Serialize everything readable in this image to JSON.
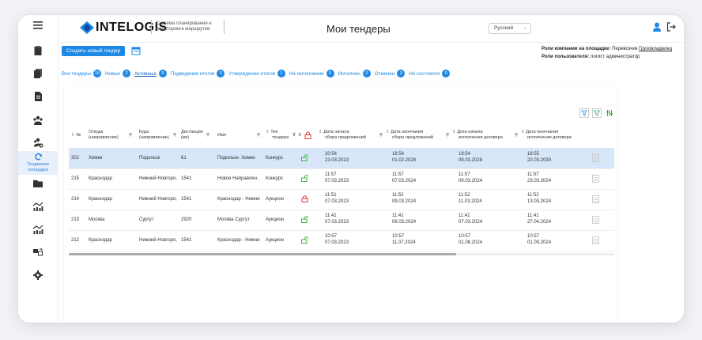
{
  "header": {
    "logo_text": "INTELOGIS",
    "logo_subtitle_line1": "Система планирования и",
    "logo_subtitle_line2": "мониторинга маршрутов",
    "page_title": "Мои тендеры",
    "language": "Русский"
  },
  "sidebar": {
    "active_label_line1": "Тендерная",
    "active_label_line2": "площадка"
  },
  "toolbar": {
    "create_label": "Создать новый тендер"
  },
  "roles": {
    "company_label": "Роли компании на площадке:",
    "company_value": "Перевозчик",
    "company_link": "Грузовладелец",
    "user_label": "Роли пользователя:",
    "user_value": "логист администратор"
  },
  "filters": [
    {
      "label": "Все тендеры",
      "count": "15"
    },
    {
      "label": "Новые",
      "count": "2"
    },
    {
      "label": "Активные",
      "count": "5"
    },
    {
      "label": "Подведение итогов",
      "count": "0"
    },
    {
      "label": "Утверждение итогов",
      "count": "1"
    },
    {
      "label": "На исполнении",
      "count": "0"
    },
    {
      "label": "Исполнен",
      "count": "3"
    },
    {
      "label": "Отменен",
      "count": "3"
    },
    {
      "label": "Не состоялся",
      "count": "0"
    }
  ],
  "table": {
    "headers": {
      "num": "№",
      "from_1": "Откуда",
      "from_2": "(направление)",
      "to_1": "Куда",
      "to_2": "(направление)",
      "dist_1": "Дистанция",
      "dist_2": "(км)",
      "name": "Имя",
      "type_1": "Тип",
      "type_2": "тендера",
      "ofs_1": "Дата начала",
      "ofs_2": "сбора предложений",
      "ofe_1": "Дата окончания",
      "ofe_2": "сбора предложений",
      "cs_1": "Дата начала",
      "cs_2": "исполнения договора",
      "ce_1": "Дата окончания",
      "ce_2": "исполнения договора"
    },
    "rows": [
      {
        "num": "302",
        "from": "Химки",
        "to": "Подольск",
        "dist": "61",
        "name": "Подольск- Химки",
        "type": "Конкурс",
        "ofs_t": "20:54",
        "ofs_d": "23.03.2023",
        "ofe_t": "18:54",
        "ofe_d": "01.02.2028",
        "cs_t": "18:54",
        "cs_d": "09.03.2028",
        "ce_t": "18:55",
        "ce_d": "22.03.2030",
        "status": "unlocked"
      },
      {
        "num": "215",
        "from": "Краснодар",
        "to": "Нижний Новгоро,",
        "dist": "1541",
        "name": "Новое Направлен..",
        "type": "Конкурс",
        "ofs_t": "11:57",
        "ofs_d": "07.03.2023",
        "ofe_t": "11:57",
        "ofe_d": "07.03.2024",
        "cs_t": "11:57",
        "cs_d": "09.03.2024",
        "ce_t": "11:57",
        "ce_d": "23.03.2024",
        "status": "unlocked"
      },
      {
        "num": "214",
        "from": "Краснодар",
        "to": "Нижний Новгоро,",
        "dist": "1541",
        "name": "Краснодар - Нижни",
        "type": "Аукцион",
        "ofs_t": "11:51",
        "ofs_d": "07.03.2023",
        "ofe_t": "11:52",
        "ofe_d": "09.03.2024",
        "cs_t": "11:52",
        "cs_d": "11.03.2024",
        "ce_t": "11:52",
        "ce_d": "13.03.2024",
        "status": "locked"
      },
      {
        "num": "213",
        "from": "Москва",
        "to": "Сургут",
        "dist": "2920",
        "name": "Москва Сургут",
        "type": "Аукцион",
        "ofs_t": "11:41",
        "ofs_d": "07.03.2023",
        "ofe_t": "11:41",
        "ofe_d": "06.03.2024",
        "cs_t": "11:41",
        "cs_d": "07.03.2024",
        "ce_t": "11:41",
        "ce_d": "27.04.2024",
        "status": "unlocked"
      },
      {
        "num": "212",
        "from": "Краснодар",
        "to": "Нижний Новгоро,",
        "dist": "1541",
        "name": "Краснодар - Нижни",
        "type": "Аукцион",
        "ofs_t": "10:57",
        "ofs_d": "07.03.2023",
        "ofe_t": "10:57",
        "ofe_d": "11.07.2024",
        "cs_t": "10:57",
        "cs_d": "01.08.2024",
        "ce_t": "10:57",
        "ce_d": "01.09.2024",
        "status": "unlocked"
      }
    ]
  },
  "colors": {
    "accent": "#1e88e5",
    "selected_row": "#d7e7f9",
    "unlocked": "#3cb043",
    "locked": "#e53935"
  }
}
